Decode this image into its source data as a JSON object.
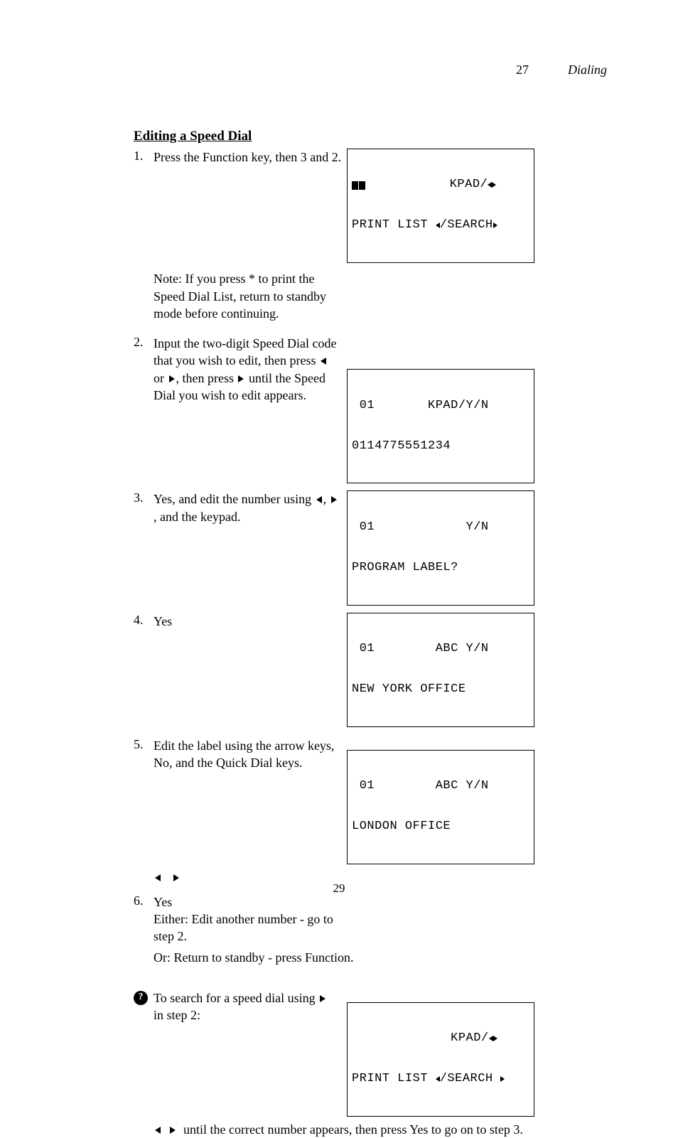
{
  "pageNumberTop": "27",
  "chapterTitle": "Dialing",
  "sectionHeading": "Editing a Speed Dial",
  "steps": {
    "1": {
      "text": "Press the Function key, then 3 and 2.",
      "lcd": {
        "line1post": "           KPAD/",
        "line2pre": "PRINT LIST ",
        "line2mid": "/SEARCH"
      }
    },
    "note1": "Note: If you press * to print the Speed Dial List, return to standby mode before continuing.",
    "2": {
      "textA": "Input the two-digit Speed Dial code that you wish to edit,\nthen press ",
      "textB": " until the\nSpeed Dial you wish to edit\nappears.",
      "lcd": {
        "line1": " 01       KPAD/Y/N",
        "line2": "0114775551234"
      }
    },
    "3": {
      "text1": "Yes, and edit the number using ",
      "text2": ", and the keypad.",
      "lcd": {
        "line1": " 01            Y/N",
        "line2": "PROGRAM LABEL?"
      }
    },
    "4": {
      "text": "Yes",
      "lcd": {
        "line1": " 01        ABC Y/N",
        "line2": "NEW YORK OFFICE"
      }
    },
    "5": {
      "text": "Edit the label using the arrow keys, No, and the Quick Dial keys.",
      "lcd": {
        "line1": " 01        ABC Y/N",
        "line2": "LONDON OFFICE"
      }
    },
    "6": {
      "text": "Yes",
      "post1": "Either: Edit another number - go to step 2.",
      "post2": "Or: Return to standby - press Function."
    }
  },
  "search": {
    "titleA": "To search for a speed dial using",
    "titleB": "in step 2:",
    "lcd": {
      "line1post": "             KPAD/",
      "line2pre": "PRINT LIST ",
      "line2mid": "/SEARCH "
    },
    "body": "until the correct number appears, then press\nYes to go on to step 3."
  },
  "footerPage": "29"
}
